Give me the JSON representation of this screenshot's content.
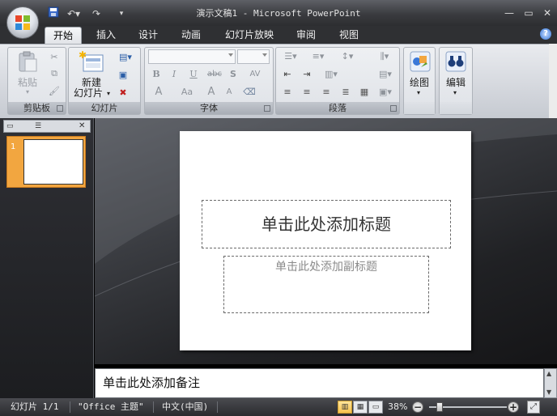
{
  "window": {
    "title": "演示文稿1 - Microsoft PowerPoint"
  },
  "qat": {
    "save_icon": "save-icon",
    "undo_icon": "undo-icon",
    "redo_icon": "redo-icon",
    "customize_icon": "dropdown-icon"
  },
  "tabs": [
    {
      "label": "开始"
    },
    {
      "label": "插入"
    },
    {
      "label": "设计"
    },
    {
      "label": "动画"
    },
    {
      "label": "幻灯片放映"
    },
    {
      "label": "审阅"
    },
    {
      "label": "视图"
    }
  ],
  "ribbon": {
    "clipboard": {
      "group": "剪贴板",
      "paste": "粘贴"
    },
    "slides": {
      "group": "幻灯片",
      "new_slide_line1": "新建",
      "new_slide_line2": "幻灯片"
    },
    "font": {
      "group": "字体",
      "bold": "B",
      "italic": "I",
      "underline": "U",
      "strike": "abc",
      "shadow": "S",
      "spacing": "AV",
      "case": "Aa",
      "grow": "A",
      "shrink": "A",
      "color": "A",
      "clear": "A"
    },
    "paragraph": {
      "group": "段落"
    },
    "drawing": {
      "label": "绘图"
    },
    "editing": {
      "label": "编辑"
    }
  },
  "slides_panel": {
    "thumb_number": "1"
  },
  "slide": {
    "title_placeholder": "单击此处添加标题",
    "subtitle_placeholder": "单击此处添加副标题"
  },
  "notes": {
    "placeholder": "单击此处添加备注"
  },
  "status": {
    "slide": "幻灯片 1/1",
    "theme": "\"Office 主题\"",
    "language": "中文(中国)",
    "zoom": "38%"
  },
  "colors": {
    "accent": "#f2a640",
    "titlebar": "#3a3b3f"
  }
}
